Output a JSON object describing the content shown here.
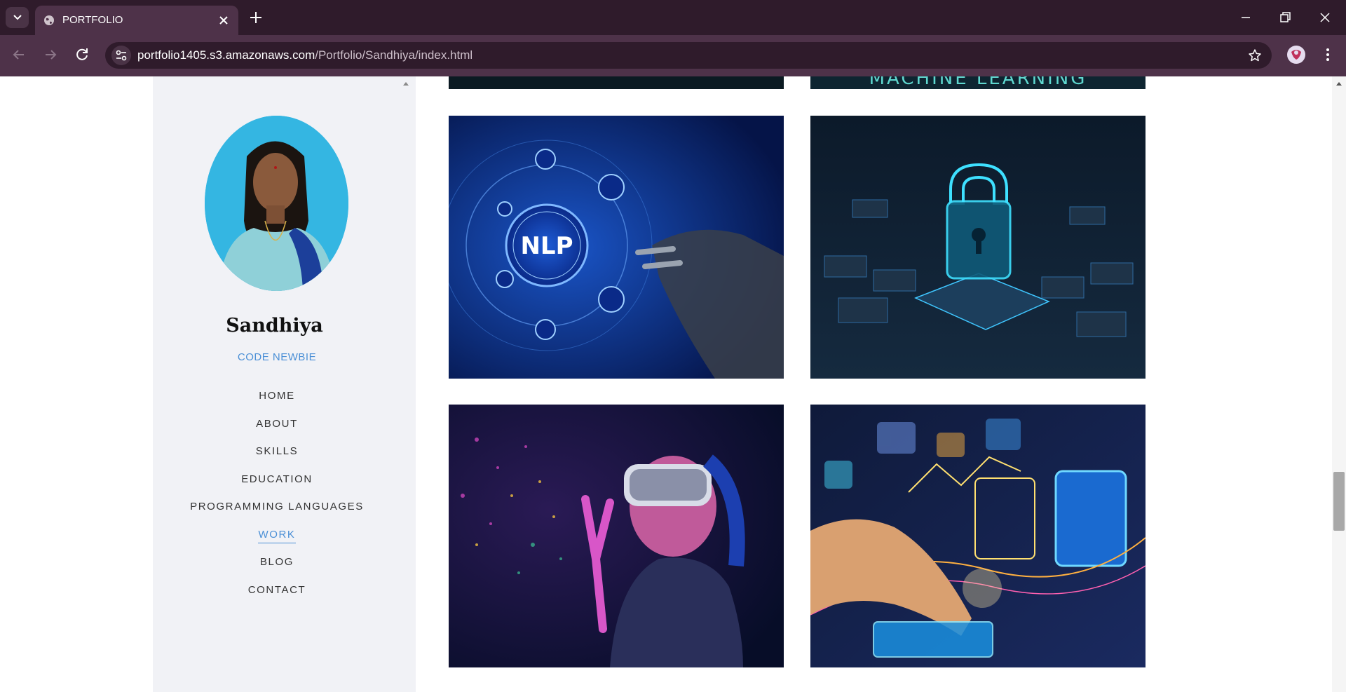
{
  "browser": {
    "tab_title": "PORTFOLIO",
    "url_domain": "portfolio1405.s3.amazonaws.com",
    "url_path": "/Portfolio/Sandhiya/index.html"
  },
  "profile": {
    "name": "Sandhiya",
    "role": "CODE NEWBIE"
  },
  "nav": {
    "items": [
      {
        "label": "HOME"
      },
      {
        "label": "ABOUT"
      },
      {
        "label": "SKILLS"
      },
      {
        "label": "EDUCATION"
      },
      {
        "label": "PROGRAMMING LANGUAGES"
      },
      {
        "label": "WORK"
      },
      {
        "label": "BLOG"
      },
      {
        "label": "CONTACT"
      }
    ],
    "active": "WORK"
  },
  "work": {
    "banner_text": "MACHINE LEARNING",
    "nlp_label": "NLP"
  },
  "colors": {
    "accent": "#4a8fd6",
    "sidebar_bg": "#f1f2f6",
    "chrome_bg": "#2f1b2b"
  }
}
